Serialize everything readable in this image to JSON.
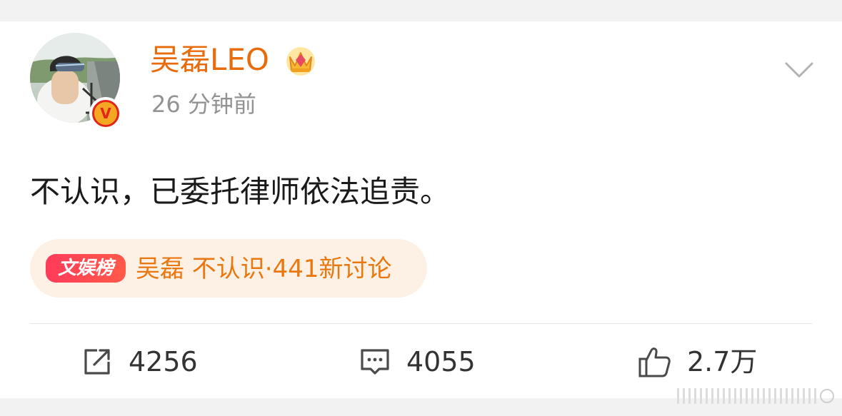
{
  "post": {
    "author": {
      "name": "吴磊LEO",
      "verified_badge_letter": "V"
    },
    "timestamp": "26 分钟前",
    "text": "不认识，已委托律师依法追责。",
    "topic": {
      "badge": "文娱榜",
      "text": "吴磊 不认识·441新讨论"
    },
    "actions": {
      "repost_count": "4256",
      "comment_count": "4055",
      "like_count": "2.7万"
    }
  },
  "colors": {
    "username": "#e86b0c",
    "timestamp": "#939393",
    "topic_text": "#e8780f",
    "topic_pill_bg": "#fdf1e5",
    "topic_badge": "#ff3b5a",
    "body_text": "#1a1a1a",
    "action_text": "#333333",
    "page_bg": "#f2f2f2"
  },
  "icons": {
    "menu": "chevron-down-icon",
    "membership": "crown-icon",
    "repost": "repost-icon",
    "comment": "comment-icon",
    "like": "thumbs-up-icon"
  }
}
